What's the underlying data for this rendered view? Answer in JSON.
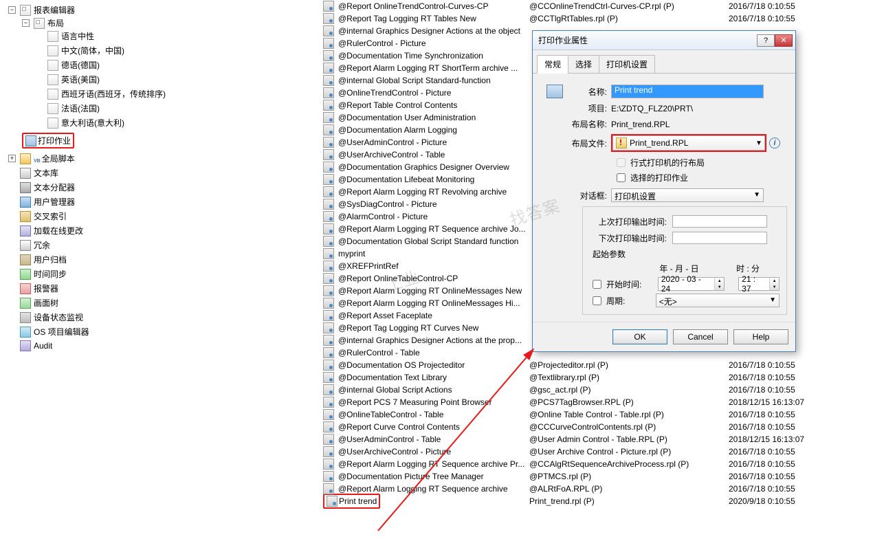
{
  "tree": {
    "root": "报表编辑器",
    "layout": "布局",
    "langs": {
      "zh_neutral": "语言中性",
      "zh_cn": "中文(简体，中国)",
      "de": "德语(德国)",
      "en": "英语(美国)",
      "es": "西班牙语(西班牙，传统排序)",
      "fr": "法语(法国)",
      "it": "意大利语(意大利)"
    },
    "print_job": "打印作业",
    "global_script": "全局脚本",
    "text_lib": "文本库",
    "text_dist": "文本分配器",
    "user_admin": "用户管理器",
    "xref": "交叉索引",
    "load_change": "加载在线更改",
    "redundancy": "冗余",
    "user_archive": "用户归档",
    "time_sync": "时间同步",
    "horn": "报警器",
    "picture_tree": "画面树",
    "dev_status": "设备状态监视",
    "os_editor": "OS 项目编辑器",
    "audit": "Audit"
  },
  "list": {
    "items": [
      {
        "nm": "@Report OnlineTrendControl-Curves-CP",
        "fn": "@CCOnlineTrendCtrl-Curves-CP.rpl (P)",
        "dt": "2016/7/18 0:10:55"
      },
      {
        "nm": "@Report Tag Logging RT Tables New",
        "fn": "@CCTlgRtTables.rpl (P)",
        "dt": "2016/7/18 0:10:55"
      },
      {
        "nm": "@internal Graphics Designer Actions at the object",
        "fn": "",
        "dt": ""
      },
      {
        "nm": "@RulerControl - Picture",
        "fn": "",
        "dt": ""
      },
      {
        "nm": "@Documentation Time Synchronization",
        "fn": "",
        "dt": ""
      },
      {
        "nm": "@Report Alarm Logging RT ShortTerm archive ...",
        "fn": "",
        "dt": ""
      },
      {
        "nm": "@internal Global Script Standard-function",
        "fn": "",
        "dt": ""
      },
      {
        "nm": "@OnlineTrendControl - Picture",
        "fn": "",
        "dt": ""
      },
      {
        "nm": "@Report Table Control Contents",
        "fn": "",
        "dt": ""
      },
      {
        "nm": "@Documentation User Administration",
        "fn": "",
        "dt": ""
      },
      {
        "nm": "@Documentation Alarm Logging",
        "fn": "",
        "dt": ""
      },
      {
        "nm": "@UserAdminControl - Picture",
        "fn": "",
        "dt": ""
      },
      {
        "nm": "@UserArchiveControl - Table",
        "fn": "",
        "dt": ""
      },
      {
        "nm": "@Documentation Graphics Designer Overview",
        "fn": "",
        "dt": ""
      },
      {
        "nm": "@Documentation Lifebeat Monitoring",
        "fn": "",
        "dt": ""
      },
      {
        "nm": "@Report Alarm Logging RT Revolving archive",
        "fn": "",
        "dt": ""
      },
      {
        "nm": "@SysDiagControl - Picture",
        "fn": "",
        "dt": ""
      },
      {
        "nm": "@AlarmControl - Picture",
        "fn": "",
        "dt": ""
      },
      {
        "nm": "@Report Alarm Logging RT Sequence archive Jo...",
        "fn": "",
        "dt": ""
      },
      {
        "nm": "@Documentation Global Script Standard function",
        "fn": "",
        "dt": ""
      },
      {
        "nm": "myprint",
        "fn": "",
        "dt": ""
      },
      {
        "nm": "@XREFPrintRef",
        "fn": "",
        "dt": ""
      },
      {
        "nm": "@Report OnlineTableControl-CP",
        "fn": "",
        "dt": ""
      },
      {
        "nm": "@Report Alarm Logging RT OnlineMessages New",
        "fn": "",
        "dt": ""
      },
      {
        "nm": "@Report Alarm Logging RT OnlineMessages Hi...",
        "fn": "",
        "dt": ""
      },
      {
        "nm": "@Report Asset Faceplate",
        "fn": "",
        "dt": ""
      },
      {
        "nm": "@Report Tag Logging RT Curves New",
        "fn": "",
        "dt": ""
      },
      {
        "nm": "@internal Graphics Designer Actions at the prop...",
        "fn": "",
        "dt": ""
      },
      {
        "nm": "@RulerControl - Table",
        "fn": "",
        "dt": ""
      },
      {
        "nm": "@Documentation OS Projecteditor",
        "fn": "@Projecteditor.rpl (P)",
        "dt": "2016/7/18 0:10:55"
      },
      {
        "nm": "@Documentation Text Library",
        "fn": "@Textlibrary.rpl (P)",
        "dt": "2016/7/18 0:10:55"
      },
      {
        "nm": "@internal Global Script Actions",
        "fn": "@gsc_act.rpl (P)",
        "dt": "2016/7/18 0:10:55"
      },
      {
        "nm": "@Report PCS 7 Measuring Point Browser",
        "fn": "@PCS7TagBrowser.RPL (P)",
        "dt": "2018/12/15 16:13:07"
      },
      {
        "nm": "@OnlineTableControl - Table",
        "fn": "@Online Table Control - Table.rpl (P)",
        "dt": "2016/7/18 0:10:55"
      },
      {
        "nm": "@Report Curve Control Contents",
        "fn": "@CCCurveControlContents.rpl (P)",
        "dt": "2016/7/18 0:10:55"
      },
      {
        "nm": "@UserAdminControl - Table",
        "fn": "@User Admin Control - Table.RPL (P)",
        "dt": "2018/12/15 16:13:07"
      },
      {
        "nm": "@UserArchiveControl - Picture",
        "fn": "@User Archive Control - Picture.rpl (P)",
        "dt": "2016/7/18 0:10:55"
      },
      {
        "nm": "@Report Alarm Logging RT Sequence archive Pr...",
        "fn": "@CCAlgRtSequenceArchiveProcess.rpl (P)",
        "dt": "2016/7/18 0:10:55"
      },
      {
        "nm": "@Documentation Picture Tree Manager",
        "fn": "@PTMCS.rpl (P)",
        "dt": "2016/7/18 0:10:55"
      },
      {
        "nm": "@Report Alarm Logging RT Sequence archive",
        "fn": "@ALRtFoA.RPL (P)",
        "dt": "2016/7/18 0:10:55"
      },
      {
        "nm": "Print trend",
        "fn": "Print_trend.rpl (P)",
        "dt": "2020/9/18 0:10:55"
      }
    ]
  },
  "dialog": {
    "title": "打印作业属性",
    "tabs": {
      "general": "常规",
      "select": "选择",
      "printer": "打印机设置"
    },
    "name_lbl": "名称:",
    "name_val": "Print trend",
    "project_lbl": "项目:",
    "project_val": "E:\\ZDTQ_FLZ20\\PRT\\",
    "layoutname_lbl": "布局名称:",
    "layoutname_val": "Print_trend.RPL",
    "layoutfile_lbl": "布局文件:",
    "layoutfile_val": "Print_trend.RPL",
    "chk_lineprinter": "行式打印机的行布局",
    "chk_selectedjob": "选择的打印作业",
    "dialogbox_lbl": "对话框:",
    "dialogbox_val": "打印机设置",
    "lastprint_lbl": "上次打印输出时间:",
    "nextprint_lbl": "下次打印输出时间:",
    "startparam_lbl": "起始参数",
    "col_date": "年 - 月 - 日",
    "col_time": "时 : 分",
    "start_chk": "开始时间:",
    "start_date": "2020 - 03 - 24",
    "start_time": "21 : 37",
    "period_chk": "周期:",
    "period_val": "<无>",
    "btn_ok": "OK",
    "btn_cancel": "Cancel",
    "btn_help": "Help"
  },
  "watermarks": {
    "w1": "找答案",
    "w2": "工业"
  }
}
